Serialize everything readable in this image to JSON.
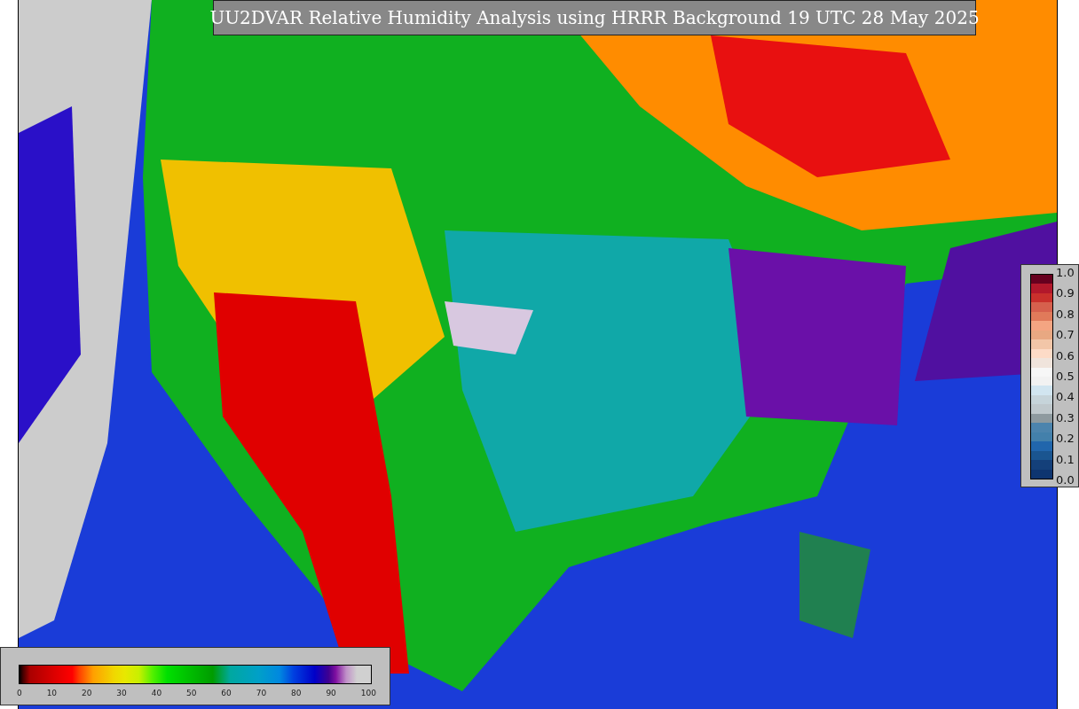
{
  "title": "UU2DVAR Relative Humidity Analysis using HRRR Background 19 UTC 28 May 2025",
  "colorbars": [
    {
      "kind": "vertical",
      "ticks": [
        "1.0",
        "0.9",
        "0.8",
        "0.7",
        "0.6",
        "0.5",
        "0.4",
        "0.3",
        "0.2",
        "0.1",
        "0.0"
      ]
    },
    {
      "kind": "horizontal",
      "ticks": [
        "0",
        "10",
        "20",
        "30",
        "40",
        "50",
        "60",
        "70",
        "80",
        "90",
        "100"
      ]
    }
  ]
}
